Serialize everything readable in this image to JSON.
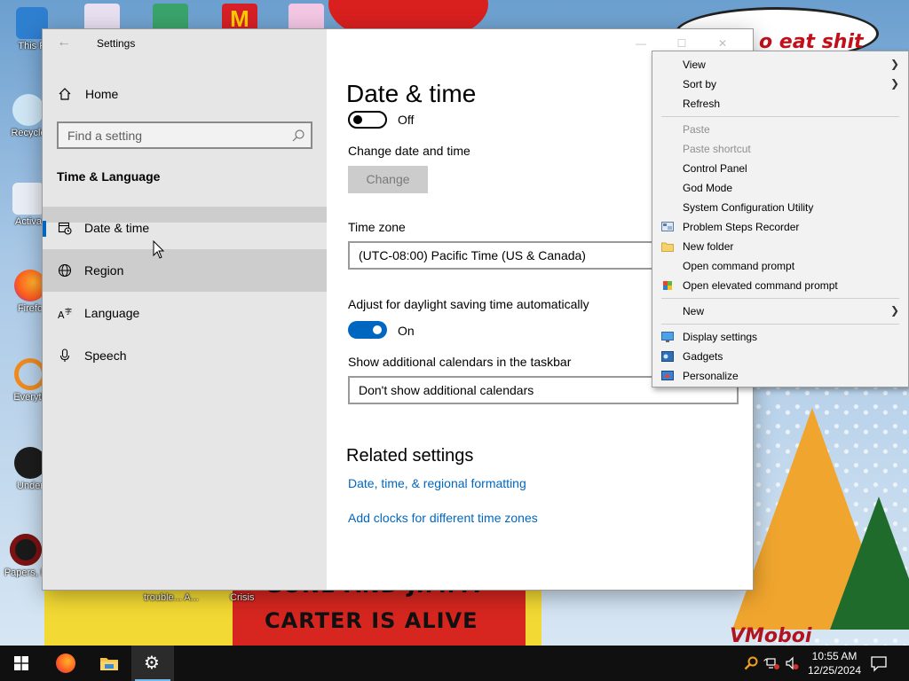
{
  "desktop": {
    "wallpaper_text_top": "o eat shit",
    "wallpaper_text_line1": "GONE AND JIMMY",
    "wallpaper_text_line2": "CARTER IS ALIVE",
    "wallpaper_sign": "VMoboi",
    "icons": [
      {
        "label": "This P",
        "icon": "this-pc-icon"
      },
      {
        "label": "Recycle",
        "icon": "recycle-bin-icon"
      },
      {
        "label": "Activa",
        "icon": "activate-icon"
      },
      {
        "label": "Firefo",
        "icon": "firefox-icon"
      },
      {
        "label": "Everyth",
        "icon": "everything-icon"
      },
      {
        "label": "Under",
        "icon": "undertale-icon"
      },
      {
        "label": "Papers, P",
        "icon": "papers-please-icon"
      }
    ],
    "bottom_labels": [
      "trouble... A...",
      "Crisis"
    ]
  },
  "settings": {
    "window_title": "Settings",
    "home_label": "Home",
    "search_placeholder": "Find a setting",
    "section_heading": "Time & Language",
    "nav": [
      {
        "label": "Date & time",
        "icon": "calendar-clock-icon",
        "selected": true
      },
      {
        "label": "Region",
        "icon": "globe-icon",
        "hover": true
      },
      {
        "label": "Language",
        "icon": "language-icon"
      },
      {
        "label": "Speech",
        "icon": "microphone-icon"
      }
    ],
    "page_title": "Date & time",
    "set_time_auto_state": "Off",
    "change_date_time_label": "Change date and time",
    "change_button": "Change",
    "time_zone_label": "Time zone",
    "time_zone_value": "(UTC-08:00) Pacific Time (US & Canada)",
    "dst_label": "Adjust for daylight saving time automatically",
    "dst_state": "On",
    "calendars_label": "Show additional calendars in the taskbar",
    "calendars_value": "Don't show additional calendars",
    "related_heading": "Related settings",
    "links": [
      "Date, time, & regional formatting",
      "Add clocks for different time zones"
    ]
  },
  "context_menu": {
    "items": [
      {
        "label": "View",
        "submenu": true
      },
      {
        "label": "Sort by",
        "submenu": true
      },
      {
        "label": "Refresh"
      },
      {
        "label": "Paste",
        "disabled": true
      },
      {
        "label": "Paste shortcut",
        "disabled": true
      },
      {
        "label": "Control Panel"
      },
      {
        "label": "God Mode"
      },
      {
        "label": "System Configuration Utility"
      },
      {
        "label": "Problem Steps Recorder",
        "icon": "steps-recorder-icon"
      },
      {
        "label": "New folder",
        "icon": "folder-icon"
      },
      {
        "label": "Open command prompt"
      },
      {
        "label": "Open elevated command prompt",
        "icon": "shield-icon"
      },
      {
        "label": "New",
        "submenu": true
      },
      {
        "label": "Display settings",
        "icon": "display-icon"
      },
      {
        "label": "Gadgets",
        "icon": "gadgets-icon"
      },
      {
        "label": "Personalize",
        "icon": "personalize-icon"
      }
    ]
  },
  "taskbar": {
    "time": "10:55 AM",
    "date": "12/25/2024",
    "pinned": [
      "start-icon",
      "firefox-icon",
      "file-explorer-icon",
      "settings-gear-icon"
    ]
  },
  "colors": {
    "accent": "#0067c0",
    "sidebar_bg": "#e6e6e6",
    "menu_bg": "#f2f2f2",
    "taskbar_bg": "#101010"
  }
}
